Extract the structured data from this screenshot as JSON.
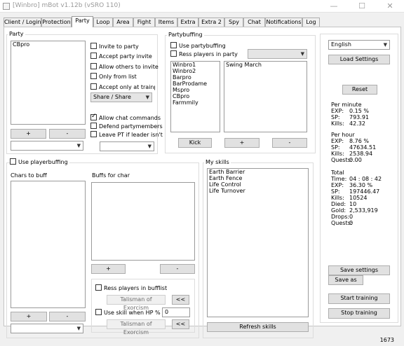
{
  "window": {
    "title": "[Winbro] mBot v1.12b (vSRO 110)",
    "status_right": "1673"
  },
  "tabs": [
    {
      "label": "Client / Login"
    },
    {
      "label": "Protection"
    },
    {
      "label": "Party"
    },
    {
      "label": "Loop"
    },
    {
      "label": "Area"
    },
    {
      "label": "Fight"
    },
    {
      "label": "Items"
    },
    {
      "label": "Extra"
    },
    {
      "label": "Extra 2"
    },
    {
      "label": "Spy"
    },
    {
      "label": "Chat"
    },
    {
      "label": "Notifications"
    },
    {
      "label": "Log"
    }
  ],
  "active_tab": "Party",
  "party": {
    "label": "Party",
    "members": [
      "CBpro"
    ],
    "add_label": "+",
    "remove_label": "-",
    "invite_to_party": "Invite to party",
    "accept_party_invite": "Accept party invite",
    "allow_others_invite": "Allow others to invite",
    "only_from_list": "Only from list",
    "accept_only_trainplace": "Accept only at trainplac",
    "share_mode": "Share / Share",
    "allow_chat_commands": "Allow chat commands",
    "defend_partymembers": "Defend partymembers",
    "leave_pt": "Leave PT if leader isn't",
    "bottom_combo": "",
    "leader_combo": ""
  },
  "partybuffing": {
    "label": "Partybuffing",
    "use_partybuffing": "Use partybuffing",
    "ress_players_in_party": "Ress players in party",
    "ress_combo": "",
    "players": [
      "Winbro1",
      "Winbro2",
      "Barpro",
      "BarProdame",
      "Mspro",
      "CBpro",
      "Farmmily"
    ],
    "skills": [
      "Swing March"
    ],
    "kick_label": "Kick",
    "add_label": "+",
    "remove_label": "-"
  },
  "playerbuffing": {
    "use_playerbuffing": "Use playerbuffing",
    "chars_to_buff_label": "Chars to buff",
    "buffs_for_char_label": "Buffs for char",
    "add_label": "+",
    "remove_label": "-",
    "chars_combo": "",
    "ress_players_in_bufflist": "Ress players in bufflist",
    "talisman_1": "Talisman of Exorcism",
    "use_skill_when_hp": "Use skill when HP % <",
    "hp_value": "0",
    "talisman_2": "Talisman of Exorcism",
    "arrow_button": "<<"
  },
  "my_skills": {
    "label": "My skills",
    "skills": [
      "Earth Barrier",
      "Earth Fence",
      "Life Control",
      "Life Turnover"
    ],
    "refresh_label": "Refresh skills"
  },
  "right": {
    "language": "English",
    "load_settings": "Load Settings",
    "reset": "Reset",
    "per_minute": {
      "head": "Per minute",
      "exp_k": "EXP:",
      "exp": "0.15 %",
      "sp_k": "SP:",
      "sp": "793.91",
      "kills_k": "Kills:",
      "kills": "42.32"
    },
    "per_hour": {
      "head": "Per hour",
      "exp_k": "EXP:",
      "exp": "8.76 %",
      "sp_k": "SP:",
      "sp": "47634.51",
      "kills_k": "Kills:",
      "kills": "2538.94",
      "quests_k": "Quests:",
      "quests": "0.00"
    },
    "total": {
      "head": "Total",
      "time_k": "Time:",
      "time": "04 : 08 : 42",
      "exp_k": "EXP:",
      "exp": "36.30 %",
      "sp_k": "SP:",
      "sp": "197446.47",
      "kills_k": "Kills:",
      "kills": "10524",
      "died_k": "Died:",
      "died": "10",
      "gold_k": "Gold:",
      "gold": "2,533,919",
      "drops_k": "Drops:",
      "drops": "0",
      "quests_k": "Quests:",
      "quests": "0"
    },
    "save_settings": "Save settings",
    "save_as": "Save as",
    "start_training": "Start training",
    "stop_training": "Stop training"
  }
}
